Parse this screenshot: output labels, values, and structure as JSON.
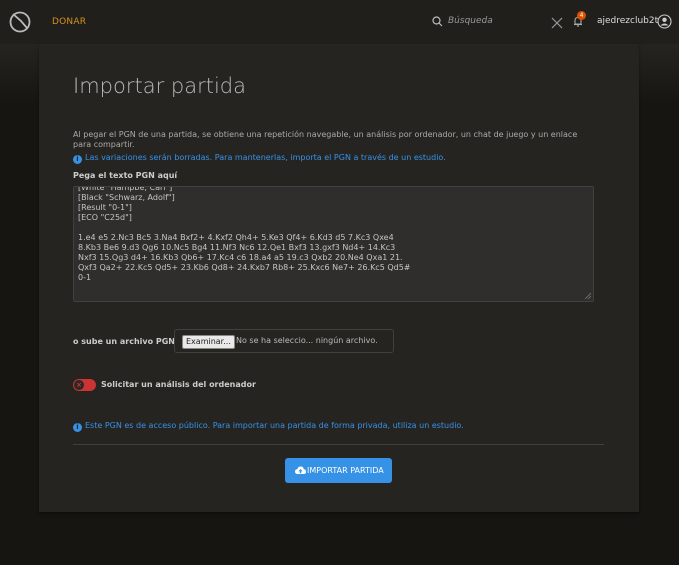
{
  "header": {
    "donate": "DONAR",
    "search_placeholder": "Búsqueda",
    "notification_count": "4",
    "username": "ajedrezclub2t"
  },
  "page": {
    "title": "Importar partida",
    "intro": "Al pegar el PGN de una partida, se obtiene una repetición navegable, un análisis por ordenador, un chat de juego y un enlace para compartir.",
    "variations_note": "Las variaciones serán borradas. Para mantenerlas, importa el PGN a través de un estudio.",
    "pgn_label": "Pega el texto PGN aquí",
    "pgn_text": "[White \"Hampbe, Carl\"]\n[Black \"Schwarz, Adolf\"]\n[Result \"0-1\"]\n[ECO \"C25d\"]\n\n1.e4 e5 2.Nc3 Bc5 3.Na4 Bxf2+ 4.Kxf2 Qh4+ 5.Ke3 Qf4+ 6.Kd3 d5 7.Kc3 Qxe4\n8.Kb3 Be6 9.d3 Qg6 10.Nc5 Bg4 11.Nf3 Nc6 12.Qe1 Bxf3 13.gxf3 Nd4+ 14.Kc3\nNxf3 15.Qg3 d4+ 16.Kb3 Qb6+ 17.Kc4 c6 18.a4 a5 19.c3 Qxb2 20.Ne4 Qxa1 21.\nQxf3 Qa2+ 22.Kc5 Qd5+ 23.Kb6 Qd8+ 24.Kxb7 Rb8+ 25.Kxc6 Ne7+ 26.Kc5 Qd5#\n0-1",
    "file_label": "o sube un archivo PGN",
    "file_button": "Examinar...",
    "file_status": "No se ha seleccio... ningún archivo.",
    "analysis_label": "Solicitar un análisis del ordenador",
    "analysis_enabled": false,
    "public_note": "Este PGN es de acceso público. Para importar una partida de forma privada, utiliza un estudio.",
    "import_button": "IMPORTAR PARTIDA"
  },
  "colors": {
    "background": "#161512",
    "panel": "#262421",
    "accent_blue": "#3692e7",
    "donate_orange": "#d59120",
    "toggle_off_red": "#cc3333"
  },
  "icons": [
    "logo-icon",
    "search-icon",
    "close-icon",
    "bell-icon",
    "user-icon",
    "info-icon",
    "upload-cloud-icon"
  ]
}
